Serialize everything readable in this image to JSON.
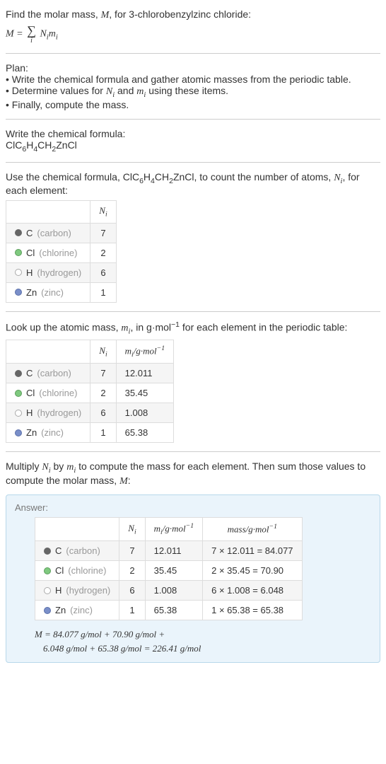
{
  "intro": {
    "line1": "Find the molar mass, ",
    "line1_var": "M",
    "line1_cont": ", for 3-chlorobenzylzinc chloride:",
    "formula_left": "M = ",
    "formula_sum_sub": "i",
    "formula_right1": "N",
    "formula_right1_sub": "i",
    "formula_right2": "m",
    "formula_right2_sub": "i"
  },
  "plan": {
    "title": "Plan:",
    "b1": "• Write the chemical formula and gather atomic masses from the periodic table.",
    "b2": "• Determine values for ",
    "b2_n": "N",
    "b2_ni": "i",
    "b2_and": " and ",
    "b2_m": "m",
    "b2_mi": "i",
    "b2_end": " using these items.",
    "b3": "• Finally, compute the mass."
  },
  "write": {
    "title": "Write the chemical formula:",
    "formula_parts": [
      "ClC",
      "6",
      "H",
      "4",
      "CH",
      "2",
      "ZnCl"
    ]
  },
  "count": {
    "intro_a": "Use the chemical formula, ClC",
    "s6": "6",
    "intro_b": "H",
    "s4": "4",
    "intro_c": "CH",
    "s2": "2",
    "intro_d": "ZnCl, to count the number of atoms, ",
    "n": "N",
    "ni": "i",
    "intro_e": ", for each element:",
    "header_n": "N",
    "header_ni": "i",
    "rows": [
      {
        "dot": "dot-gray",
        "sym": "C",
        "name": "(carbon)",
        "n": "7"
      },
      {
        "dot": "dot-green",
        "sym": "Cl",
        "name": "(chlorine)",
        "n": "2"
      },
      {
        "dot": "dot-white",
        "sym": "H",
        "name": "(hydrogen)",
        "n": "6"
      },
      {
        "dot": "dot-blue",
        "sym": "Zn",
        "name": "(zinc)",
        "n": "1"
      }
    ]
  },
  "lookup": {
    "intro_a": "Look up the atomic mass, ",
    "m": "m",
    "mi": "i",
    "intro_b": ", in g·mol",
    "exp": "−1",
    "intro_c": " for each element in the periodic table:",
    "header_n": "N",
    "header_ni": "i",
    "header_m": "m",
    "header_mi": "i",
    "header_unit": "/g·mol",
    "header_exp": "−1",
    "rows": [
      {
        "dot": "dot-gray",
        "sym": "C",
        "name": "(carbon)",
        "n": "7",
        "m": "12.011"
      },
      {
        "dot": "dot-green",
        "sym": "Cl",
        "name": "(chlorine)",
        "n": "2",
        "m": "35.45"
      },
      {
        "dot": "dot-white",
        "sym": "H",
        "name": "(hydrogen)",
        "n": "6",
        "m": "1.008"
      },
      {
        "dot": "dot-blue",
        "sym": "Zn",
        "name": "(zinc)",
        "n": "1",
        "m": "65.38"
      }
    ]
  },
  "multiply": {
    "intro_a": "Multiply ",
    "n": "N",
    "ni": "i",
    "by": " by ",
    "m": "m",
    "mi": "i",
    "intro_b": " to compute the mass for each element. Then sum those values to compute the molar mass, ",
    "M": "M",
    "intro_c": ":"
  },
  "answer": {
    "title": "Answer:",
    "header_n": "N",
    "header_ni": "i",
    "header_m": "m",
    "header_mi": "i",
    "header_unit": "/g·mol",
    "header_exp": "−1",
    "header_mass": "mass/g·mol",
    "header_mass_exp": "−1",
    "rows": [
      {
        "dot": "dot-gray",
        "sym": "C",
        "name": "(carbon)",
        "n": "7",
        "m": "12.011",
        "mass": "7 × 12.011 = 84.077"
      },
      {
        "dot": "dot-green",
        "sym": "Cl",
        "name": "(chlorine)",
        "n": "2",
        "m": "35.45",
        "mass": "2 × 35.45 = 70.90"
      },
      {
        "dot": "dot-white",
        "sym": "H",
        "name": "(hydrogen)",
        "n": "6",
        "m": "1.008",
        "mass": "6 × 1.008 = 6.048"
      },
      {
        "dot": "dot-blue",
        "sym": "Zn",
        "name": "(zinc)",
        "n": "1",
        "m": "65.38",
        "mass": "1 × 65.38 = 65.38"
      }
    ],
    "final_line1": "M = 84.077 g/mol + 70.90 g/mol +",
    "final_line2": "6.048 g/mol + 65.38 g/mol = 226.41 g/mol"
  }
}
